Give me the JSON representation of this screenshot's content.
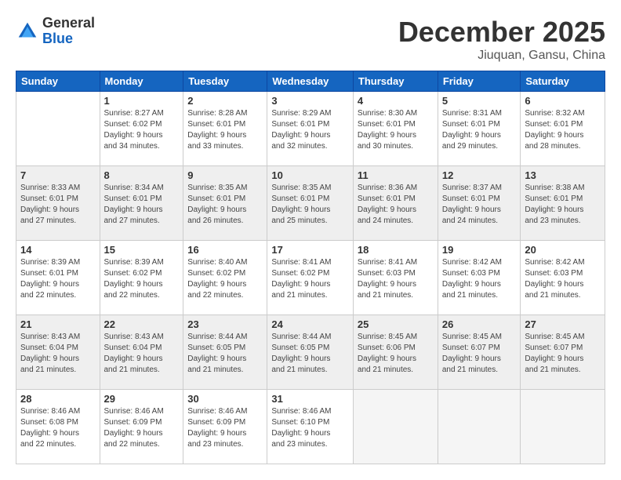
{
  "logo": {
    "general": "General",
    "blue": "Blue"
  },
  "title": "December 2025",
  "location": "Jiuquan, Gansu, China",
  "weekdays": [
    "Sunday",
    "Monday",
    "Tuesday",
    "Wednesday",
    "Thursday",
    "Friday",
    "Saturday"
  ],
  "weeks": [
    [
      {
        "day": "",
        "info": ""
      },
      {
        "day": "1",
        "info": "Sunrise: 8:27 AM\nSunset: 6:02 PM\nDaylight: 9 hours\nand 34 minutes."
      },
      {
        "day": "2",
        "info": "Sunrise: 8:28 AM\nSunset: 6:01 PM\nDaylight: 9 hours\nand 33 minutes."
      },
      {
        "day": "3",
        "info": "Sunrise: 8:29 AM\nSunset: 6:01 PM\nDaylight: 9 hours\nand 32 minutes."
      },
      {
        "day": "4",
        "info": "Sunrise: 8:30 AM\nSunset: 6:01 PM\nDaylight: 9 hours\nand 30 minutes."
      },
      {
        "day": "5",
        "info": "Sunrise: 8:31 AM\nSunset: 6:01 PM\nDaylight: 9 hours\nand 29 minutes."
      },
      {
        "day": "6",
        "info": "Sunrise: 8:32 AM\nSunset: 6:01 PM\nDaylight: 9 hours\nand 28 minutes."
      }
    ],
    [
      {
        "day": "7",
        "info": "Sunrise: 8:33 AM\nSunset: 6:01 PM\nDaylight: 9 hours\nand 27 minutes."
      },
      {
        "day": "8",
        "info": "Sunrise: 8:34 AM\nSunset: 6:01 PM\nDaylight: 9 hours\nand 27 minutes."
      },
      {
        "day": "9",
        "info": "Sunrise: 8:35 AM\nSunset: 6:01 PM\nDaylight: 9 hours\nand 26 minutes."
      },
      {
        "day": "10",
        "info": "Sunrise: 8:35 AM\nSunset: 6:01 PM\nDaylight: 9 hours\nand 25 minutes."
      },
      {
        "day": "11",
        "info": "Sunrise: 8:36 AM\nSunset: 6:01 PM\nDaylight: 9 hours\nand 24 minutes."
      },
      {
        "day": "12",
        "info": "Sunrise: 8:37 AM\nSunset: 6:01 PM\nDaylight: 9 hours\nand 24 minutes."
      },
      {
        "day": "13",
        "info": "Sunrise: 8:38 AM\nSunset: 6:01 PM\nDaylight: 9 hours\nand 23 minutes."
      }
    ],
    [
      {
        "day": "14",
        "info": "Sunrise: 8:39 AM\nSunset: 6:01 PM\nDaylight: 9 hours\nand 22 minutes."
      },
      {
        "day": "15",
        "info": "Sunrise: 8:39 AM\nSunset: 6:02 PM\nDaylight: 9 hours\nand 22 minutes."
      },
      {
        "day": "16",
        "info": "Sunrise: 8:40 AM\nSunset: 6:02 PM\nDaylight: 9 hours\nand 22 minutes."
      },
      {
        "day": "17",
        "info": "Sunrise: 8:41 AM\nSunset: 6:02 PM\nDaylight: 9 hours\nand 21 minutes."
      },
      {
        "day": "18",
        "info": "Sunrise: 8:41 AM\nSunset: 6:03 PM\nDaylight: 9 hours\nand 21 minutes."
      },
      {
        "day": "19",
        "info": "Sunrise: 8:42 AM\nSunset: 6:03 PM\nDaylight: 9 hours\nand 21 minutes."
      },
      {
        "day": "20",
        "info": "Sunrise: 8:42 AM\nSunset: 6:03 PM\nDaylight: 9 hours\nand 21 minutes."
      }
    ],
    [
      {
        "day": "21",
        "info": "Sunrise: 8:43 AM\nSunset: 6:04 PM\nDaylight: 9 hours\nand 21 minutes."
      },
      {
        "day": "22",
        "info": "Sunrise: 8:43 AM\nSunset: 6:04 PM\nDaylight: 9 hours\nand 21 minutes."
      },
      {
        "day": "23",
        "info": "Sunrise: 8:44 AM\nSunset: 6:05 PM\nDaylight: 9 hours\nand 21 minutes."
      },
      {
        "day": "24",
        "info": "Sunrise: 8:44 AM\nSunset: 6:05 PM\nDaylight: 9 hours\nand 21 minutes."
      },
      {
        "day": "25",
        "info": "Sunrise: 8:45 AM\nSunset: 6:06 PM\nDaylight: 9 hours\nand 21 minutes."
      },
      {
        "day": "26",
        "info": "Sunrise: 8:45 AM\nSunset: 6:07 PM\nDaylight: 9 hours\nand 21 minutes."
      },
      {
        "day": "27",
        "info": "Sunrise: 8:45 AM\nSunset: 6:07 PM\nDaylight: 9 hours\nand 21 minutes."
      }
    ],
    [
      {
        "day": "28",
        "info": "Sunrise: 8:46 AM\nSunset: 6:08 PM\nDaylight: 9 hours\nand 22 minutes."
      },
      {
        "day": "29",
        "info": "Sunrise: 8:46 AM\nSunset: 6:09 PM\nDaylight: 9 hours\nand 22 minutes."
      },
      {
        "day": "30",
        "info": "Sunrise: 8:46 AM\nSunset: 6:09 PM\nDaylight: 9 hours\nand 23 minutes."
      },
      {
        "day": "31",
        "info": "Sunrise: 8:46 AM\nSunset: 6:10 PM\nDaylight: 9 hours\nand 23 minutes."
      },
      {
        "day": "",
        "info": ""
      },
      {
        "day": "",
        "info": ""
      },
      {
        "day": "",
        "info": ""
      }
    ]
  ]
}
